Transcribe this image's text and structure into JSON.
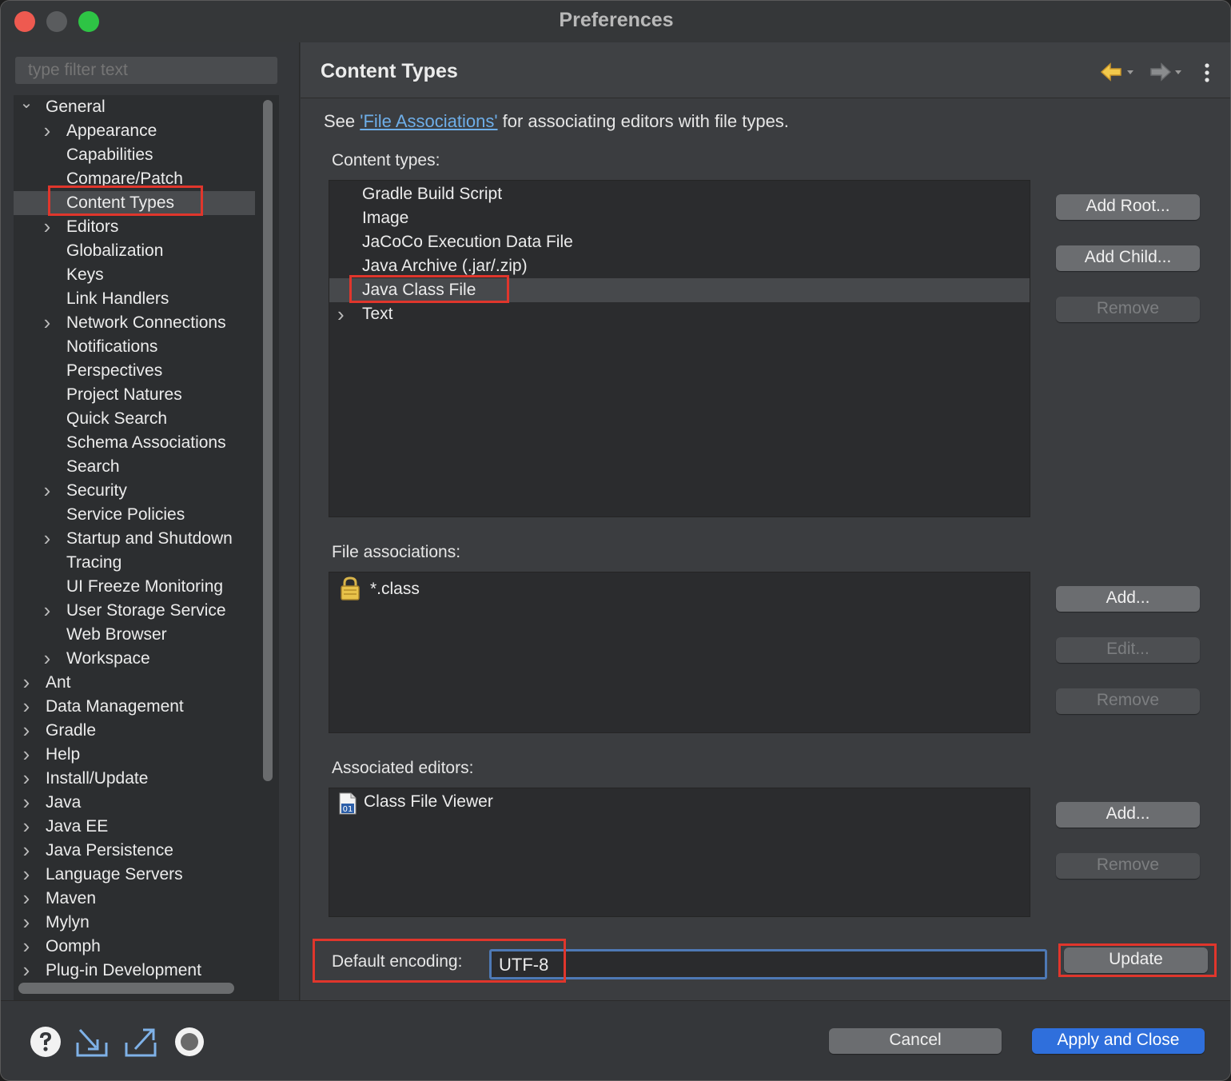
{
  "window": {
    "title": "Preferences"
  },
  "filter": {
    "placeholder": "type filter text"
  },
  "tree": [
    {
      "label": "General",
      "expandable": true,
      "expanded": true,
      "level": 0
    },
    {
      "label": "Appearance",
      "expandable": true,
      "level": 1
    },
    {
      "label": "Capabilities",
      "expandable": false,
      "level": 1
    },
    {
      "label": "Compare/Patch",
      "expandable": false,
      "level": 1
    },
    {
      "label": "Content Types",
      "expandable": false,
      "level": 1,
      "selected": true
    },
    {
      "label": "Editors",
      "expandable": true,
      "level": 1
    },
    {
      "label": "Globalization",
      "expandable": false,
      "level": 1
    },
    {
      "label": "Keys",
      "expandable": false,
      "level": 1
    },
    {
      "label": "Link Handlers",
      "expandable": false,
      "level": 1
    },
    {
      "label": "Network Connections",
      "expandable": true,
      "level": 1
    },
    {
      "label": "Notifications",
      "expandable": false,
      "level": 1
    },
    {
      "label": "Perspectives",
      "expandable": false,
      "level": 1
    },
    {
      "label": "Project Natures",
      "expandable": false,
      "level": 1
    },
    {
      "label": "Quick Search",
      "expandable": false,
      "level": 1
    },
    {
      "label": "Schema Associations",
      "expandable": false,
      "level": 1
    },
    {
      "label": "Search",
      "expandable": false,
      "level": 1
    },
    {
      "label": "Security",
      "expandable": true,
      "level": 1
    },
    {
      "label": "Service Policies",
      "expandable": false,
      "level": 1
    },
    {
      "label": "Startup and Shutdown",
      "expandable": true,
      "level": 1
    },
    {
      "label": "Tracing",
      "expandable": false,
      "level": 1
    },
    {
      "label": "UI Freeze Monitoring",
      "expandable": false,
      "level": 1
    },
    {
      "label": "User Storage Service",
      "expandable": true,
      "level": 1
    },
    {
      "label": "Web Browser",
      "expandable": false,
      "level": 1
    },
    {
      "label": "Workspace",
      "expandable": true,
      "level": 1
    },
    {
      "label": "Ant",
      "expandable": true,
      "level": 0
    },
    {
      "label": "Data Management",
      "expandable": true,
      "level": 0
    },
    {
      "label": "Gradle",
      "expandable": true,
      "level": 0
    },
    {
      "label": "Help",
      "expandable": true,
      "level": 0
    },
    {
      "label": "Install/Update",
      "expandable": true,
      "level": 0
    },
    {
      "label": "Java",
      "expandable": true,
      "level": 0
    },
    {
      "label": "Java EE",
      "expandable": true,
      "level": 0
    },
    {
      "label": "Java Persistence",
      "expandable": true,
      "level": 0
    },
    {
      "label": "Language Servers",
      "expandable": true,
      "level": 0
    },
    {
      "label": "Maven",
      "expandable": true,
      "level": 0
    },
    {
      "label": "Mylyn",
      "expandable": true,
      "level": 0
    },
    {
      "label": "Oomph",
      "expandable": true,
      "level": 0
    },
    {
      "label": "Plug-in Development",
      "expandable": true,
      "level": 0
    }
  ],
  "page": {
    "title": "Content Types",
    "desc_prefix": "See ",
    "desc_link": "'File Associations'",
    "desc_suffix": " for associating editors with file types."
  },
  "content_types": {
    "label": "Content types:",
    "items": [
      {
        "label": "Gradle Build Script",
        "expandable": false
      },
      {
        "label": "Image",
        "expandable": false
      },
      {
        "label": "JaCoCo Execution Data File",
        "expandable": false
      },
      {
        "label": "Java Archive (.jar/.zip)",
        "expandable": false
      },
      {
        "label": "Java Class File",
        "expandable": false,
        "selected": true
      },
      {
        "label": "Text",
        "expandable": true
      }
    ],
    "buttons": {
      "add_root": "Add Root...",
      "add_child": "Add Child...",
      "remove": "Remove"
    }
  },
  "file_associations": {
    "label": "File associations:",
    "items": [
      {
        "label": "*.class",
        "icon": "lock-icon"
      }
    ],
    "buttons": {
      "add": "Add...",
      "edit": "Edit...",
      "remove": "Remove"
    }
  },
  "associated_editors": {
    "label": "Associated editors:",
    "items": [
      {
        "label": "Class File Viewer",
        "icon": "class-file-icon"
      }
    ],
    "buttons": {
      "add": "Add...",
      "remove": "Remove"
    }
  },
  "encoding": {
    "label": "Default encoding:",
    "value": "UTF-8",
    "update_label": "Update"
  },
  "footer": {
    "cancel_label": "Cancel",
    "apply_close_label": "Apply and Close"
  },
  "colors": {
    "accent": "#2f6fdc",
    "highlight": "#e0362c",
    "link": "#6eaee8"
  }
}
